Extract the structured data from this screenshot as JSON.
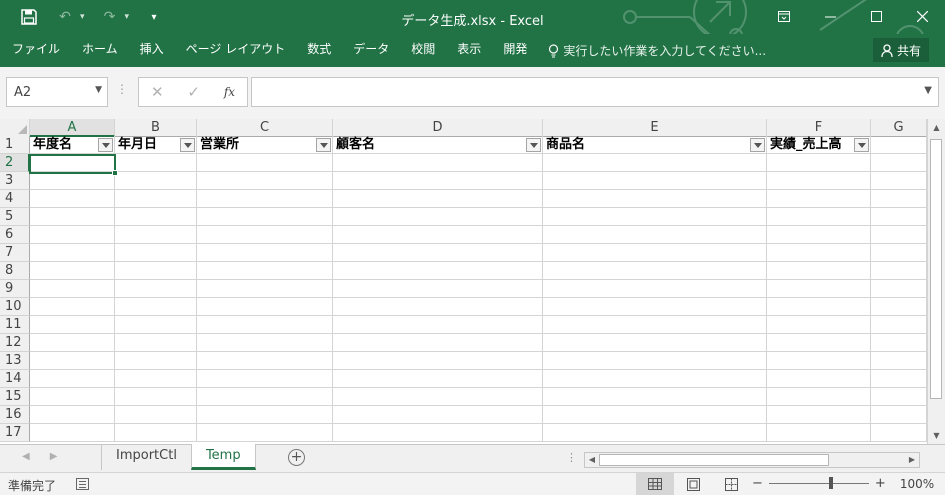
{
  "app": {
    "window_title": "データ生成.xlsx - Excel",
    "accent_color": "#217346"
  },
  "quick_access": [
    {
      "icon": "save-icon"
    },
    {
      "icon": "undo-icon"
    },
    {
      "icon": "redo-icon"
    },
    {
      "icon": "customize-qat-icon"
    }
  ],
  "ribbon": {
    "tabs": [
      "ファイル",
      "ホーム",
      "挿入",
      "ページ レイアウト",
      "数式",
      "データ",
      "校閲",
      "表示",
      "開発"
    ],
    "tell_me": "実行したい作業を入力してください...",
    "share": "共有"
  },
  "formula_bar": {
    "name_box": "A2",
    "cancel": "✕",
    "enter": "✓",
    "fx": "fx",
    "formula": ""
  },
  "sheet": {
    "columns": [
      "A",
      "B",
      "C",
      "D",
      "E",
      "F",
      "G"
    ],
    "rows": [
      "1",
      "2",
      "3",
      "4",
      "5",
      "6",
      "7",
      "8",
      "9",
      "10",
      "11",
      "12",
      "13",
      "14",
      "15",
      "16",
      "17"
    ],
    "headers": [
      "年度名",
      "年月日",
      "営業所",
      "顧客名",
      "商品名",
      "実績_売上高"
    ],
    "active_cell": "A2"
  },
  "sheet_tabs": {
    "tabs": [
      "ImportCtl",
      "Temp"
    ],
    "active": "Temp"
  },
  "status_bar": {
    "status": "準備完了",
    "zoom": "100%",
    "zoom_minus": "−",
    "zoom_plus": "+"
  }
}
